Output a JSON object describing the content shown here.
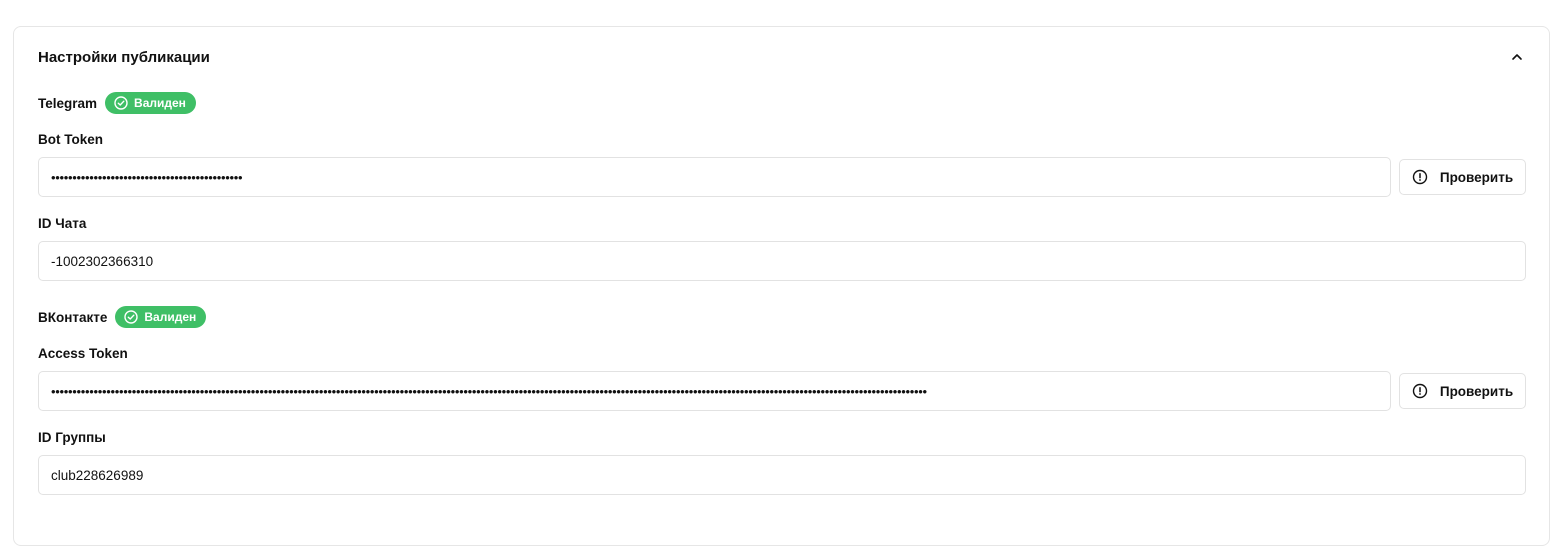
{
  "card": {
    "title": "Настройки публикации"
  },
  "telegram": {
    "name": "Telegram",
    "badge": "Валиден",
    "bot_token_label": "Bot Token",
    "bot_token_value": "•••••••••••••••••••••••••••••••••••••••••••••",
    "check_button": "Проверить",
    "chat_id_label": "ID Чата",
    "chat_id_value": "-1002302366310"
  },
  "vk": {
    "name": "ВКонтакте",
    "badge": "Валиден",
    "access_token_label": "Access Token",
    "access_token_value": "••••••••••••••••••••••••••••••••••••••••••••••••••••••••••••••••••••••••••••••••••••••••••••••••••••••••••••••••••••••••••••••••••••••••••••••••••••••••••••••••••••••••••••••••••••••••••••••••••••••••••••••",
    "check_button": "Проверить",
    "group_id_label": "ID Группы",
    "group_id_value": "club228626989"
  },
  "colors": {
    "badge_green": "#3fbf66",
    "border": "#e2e2e2"
  },
  "icons": {
    "collapse": "chevron-up-icon",
    "badge": "check-circle-icon",
    "check": "alert-circle-icon"
  }
}
